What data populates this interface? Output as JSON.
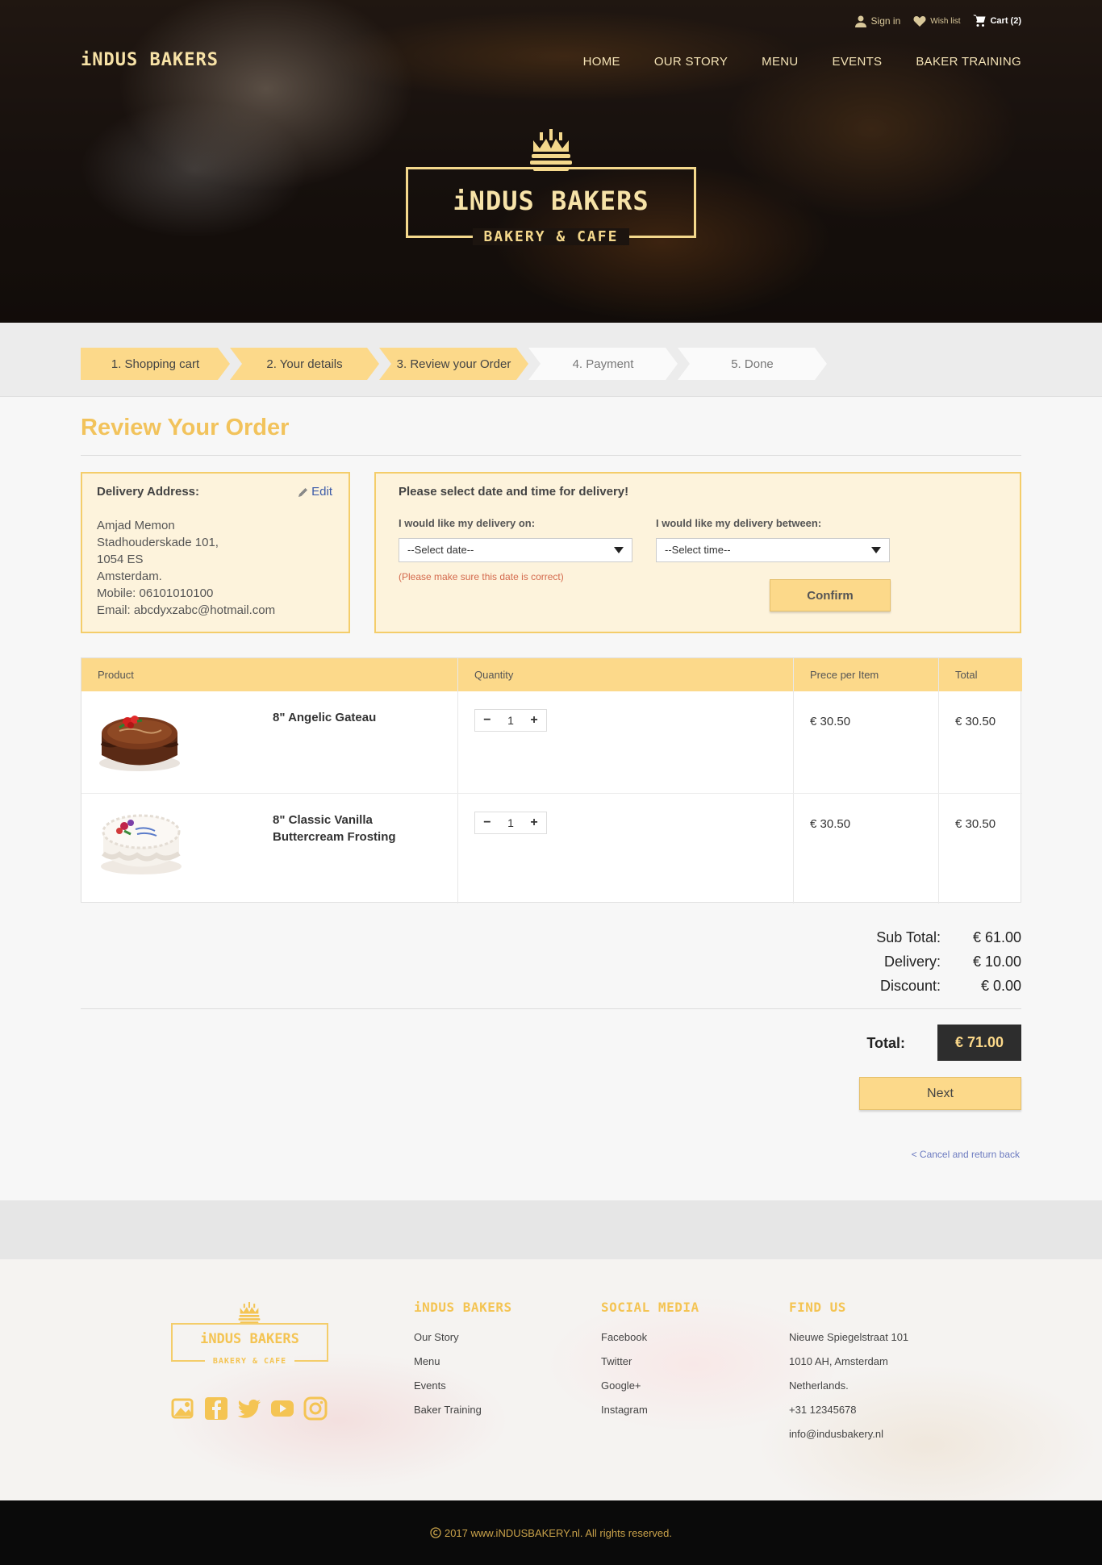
{
  "header": {
    "brand": "iNDUS BAKERS",
    "utility": {
      "sign_in": "Sign in",
      "wish_list": "Wish list",
      "cart": "Cart (2)"
    },
    "nav": [
      "HOME",
      "OUR STORY",
      "MENU",
      "EVENTS",
      "BAKER TRAINING"
    ],
    "hero_logo": {
      "title": "iNDUS BAKERS",
      "subtitle": "BAKERY & CAFE"
    }
  },
  "steps": [
    {
      "label": "1. Shopping cart",
      "state": "done"
    },
    {
      "label": "2. Your details",
      "state": "done"
    },
    {
      "label": "3. Review your Order",
      "state": "active"
    },
    {
      "label": "4. Payment",
      "state": "pending"
    },
    {
      "label": "5. Done",
      "state": "pending"
    }
  ],
  "page": {
    "title": "Review Your Order"
  },
  "address": {
    "heading": "Delivery Address:",
    "edit_label": "Edit",
    "lines": [
      "Amjad Memon",
      "Stadhouderskade 101,",
      "1054 ES",
      "Amsterdam.",
      "Mobile: 06101010100",
      "Email: abcdyxzabc@hotmail.com"
    ]
  },
  "delivery": {
    "heading": "Please select date and time for delivery!",
    "date_label": "I would like my delivery on:",
    "time_label": "I would like my delivery between:",
    "date_value": "--Select date--",
    "time_value": "--Select time--",
    "warning": "(Please make sure this date is correct)",
    "confirm_label": "Confirm"
  },
  "table": {
    "headers": [
      "Product",
      "Quantity",
      "Prece per Item",
      "Total"
    ],
    "rows": [
      {
        "name": "8\" Angelic Gateau",
        "qty": "1",
        "price": "€ 30.50",
        "total": "€ 30.50"
      },
      {
        "name": "8\" Classic Vanilla Buttercream Frosting",
        "qty": "1",
        "price": "€ 30.50",
        "total": "€ 30.50"
      }
    ]
  },
  "totals": {
    "subtotal_label": "Sub Total:",
    "subtotal": "€ 61.00",
    "delivery_label": "Delivery:",
    "delivery": "€ 10.00",
    "discount_label": "Discount:",
    "discount": "€ 0.00",
    "total_label": "Total:",
    "total": "€ 71.00"
  },
  "actions": {
    "next_label": "Next",
    "cancel_label": "< Cancel and return back"
  },
  "footer": {
    "logo_title": "iNDUS BAKERS",
    "logo_subtitle": "BAKERY & CAFE",
    "col1": {
      "title": "iNDUS BAKERS",
      "items": [
        "Our Story",
        "Menu",
        "Events",
        "Baker Training"
      ]
    },
    "col2": {
      "title": "SOCIAL MEDIA",
      "items": [
        "Facebook",
        "Twitter",
        "Google+",
        "Instagram"
      ]
    },
    "col3": {
      "title": "FIND US",
      "items": [
        "Nieuwe Spiegelstraat 101",
        "1010 AH, Amsterdam",
        "Netherlands.",
        "+31 12345678",
        "info@indusbakery.nl"
      ]
    },
    "social_icons": [
      "photos-icon",
      "facebook-icon",
      "twitter-icon",
      "youtube-icon",
      "instagram-icon"
    ],
    "copyright": "2017 www.iNDUSBAKERY.nl. All rights reserved."
  },
  "colors": {
    "accent": "#fcd98a",
    "accent_dark": "#f4c453",
    "title": "#f2c35c",
    "total_bg": "#2d2d2d",
    "warning": "#d46a4d"
  }
}
